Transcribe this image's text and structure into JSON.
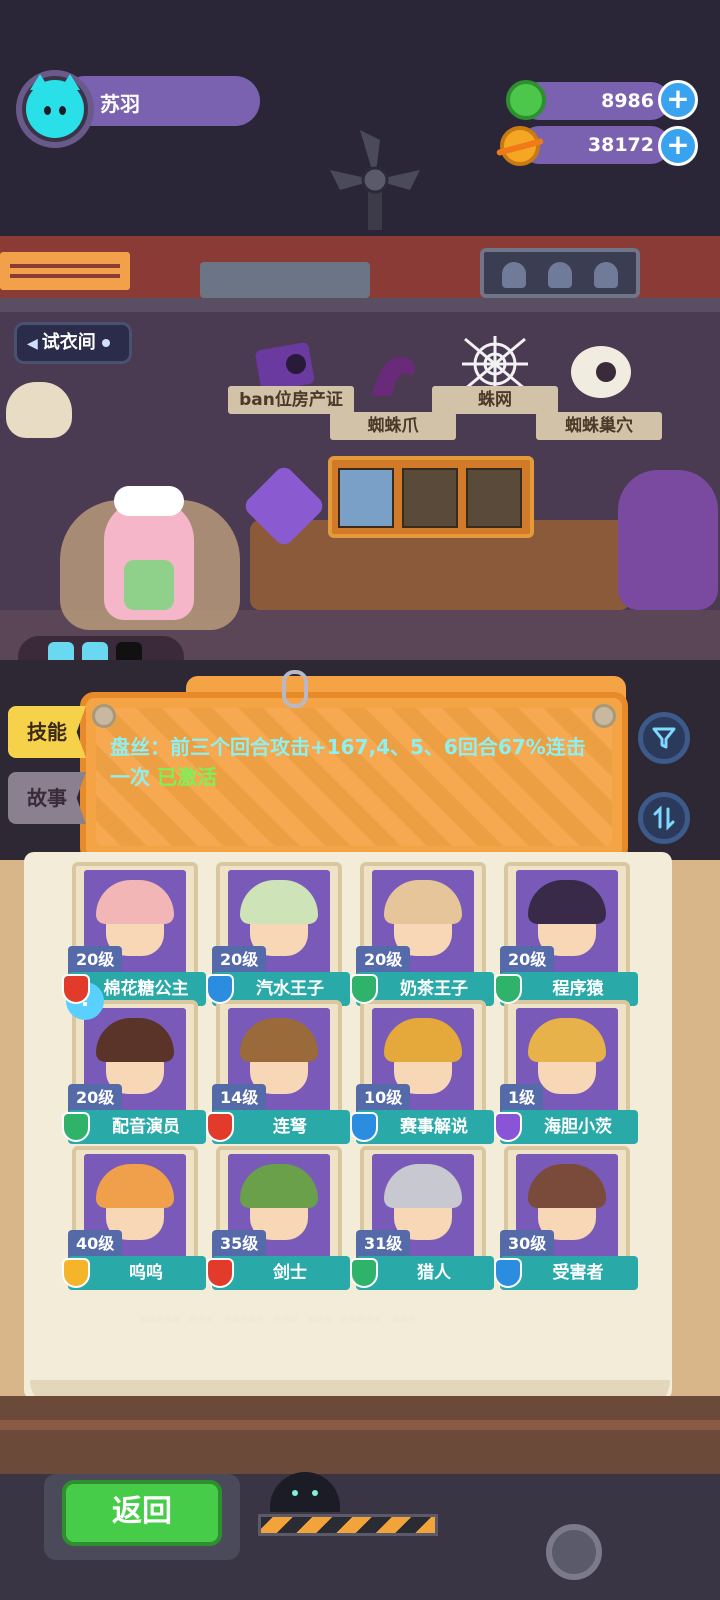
{
  "player": {
    "name": "苏羽",
    "avatar_icon": "cat-face-icon"
  },
  "currency": [
    {
      "icon": "green-donut-gem-icon",
      "value": "8986",
      "add_label": "+"
    },
    {
      "icon": "orange-planet-coin-icon",
      "value": "38172",
      "add_label": "+"
    }
  ],
  "scene": {
    "fitting_room_label": "试衣间",
    "item_labels": [
      "ban位房产证",
      "蜘蛛爪",
      "蛛网",
      "蜘蛛巢穴"
    ]
  },
  "tabs": {
    "skill": "技能",
    "story": "故事"
  },
  "skill": {
    "text": "盘丝：前三个回合攻击+167,4、5、6回合67%连击一次",
    "status": "已激活"
  },
  "buttons": {
    "filter_icon": "funnel-icon",
    "sort_icon": "swap-arrows-icon",
    "return": "返回"
  },
  "characters": [
    {
      "name": "棉花糖公主",
      "level": "20级",
      "shield": "red",
      "art": "#f2b6b6"
    },
    {
      "name": "汽水王子",
      "level": "20级",
      "shield": "blue",
      "art": "#cfe3b8"
    },
    {
      "name": "奶茶王子",
      "level": "20级",
      "shield": "green",
      "art": "#e6c59a"
    },
    {
      "name": "程序猿",
      "level": "20级",
      "shield": "green",
      "art": "#3a2a4a"
    },
    {
      "name": "配音演员",
      "level": "20级",
      "shield": "green",
      "art": "#5a3428"
    },
    {
      "name": "连弩",
      "level": "14级",
      "shield": "red",
      "art": "#9a6a3a"
    },
    {
      "name": "赛事解说",
      "level": "10级",
      "shield": "blue",
      "art": "#e5a83a"
    },
    {
      "name": "海胆小茨",
      "level": "1级",
      "shield": "purple",
      "art": "#e8b24a"
    },
    {
      "name": "呜呜",
      "level": "40级",
      "shield": "yellow",
      "art": "#f0a04a"
    },
    {
      "name": "剑士",
      "level": "35级",
      "shield": "red",
      "art": "#6aa04a"
    },
    {
      "name": "猎人",
      "level": "31级",
      "shield": "green",
      "art": "#c8c8d0"
    },
    {
      "name": "受害者",
      "level": "30级",
      "shield": "blue",
      "art": "#7a4a3a"
    }
  ],
  "alert_icon": "exclamation-icon",
  "blurred_text": "·····  ···  ·····  ···  ··· ·····  ···"
}
